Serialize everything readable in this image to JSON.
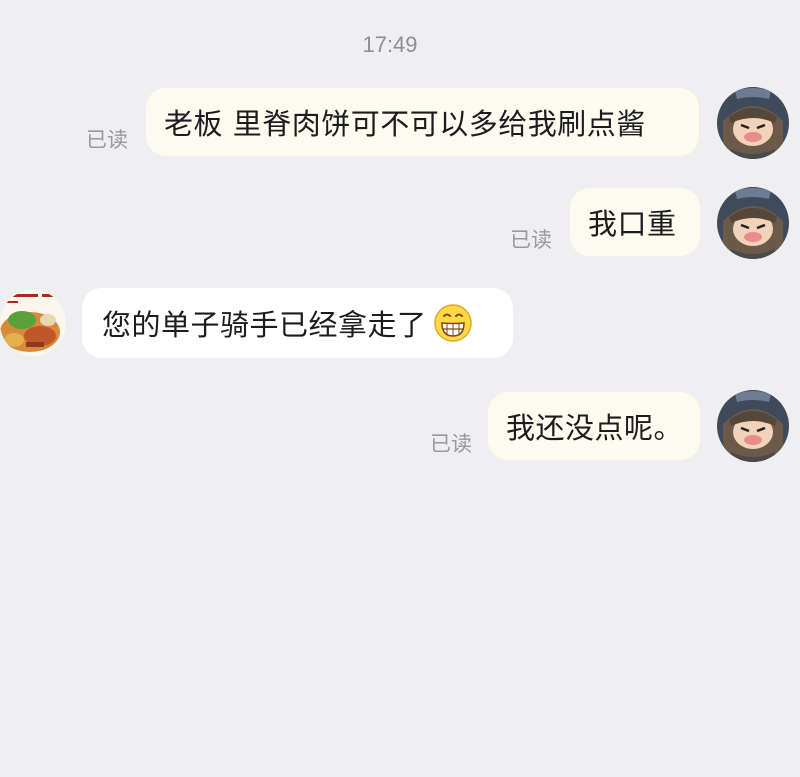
{
  "chat": {
    "time": "17:49",
    "messages": [
      {
        "side": "out",
        "text": "老板 里脊肉饼可不可以多给我刷点酱",
        "status": "已读"
      },
      {
        "side": "out",
        "text": "我口重",
        "status": "已读"
      },
      {
        "side": "in",
        "text": "您的单子骑手已经拿走了",
        "emoji": "grinning-face-icon"
      },
      {
        "side": "out",
        "text": "我还没点呢。",
        "status": "已读"
      }
    ]
  },
  "colors": {
    "background": "#efeff1",
    "outgoing_bubble": "#fdfbf0",
    "incoming_bubble": "#ffffff",
    "text": "#1c1c1e",
    "meta_text": "#9a9a9e"
  }
}
